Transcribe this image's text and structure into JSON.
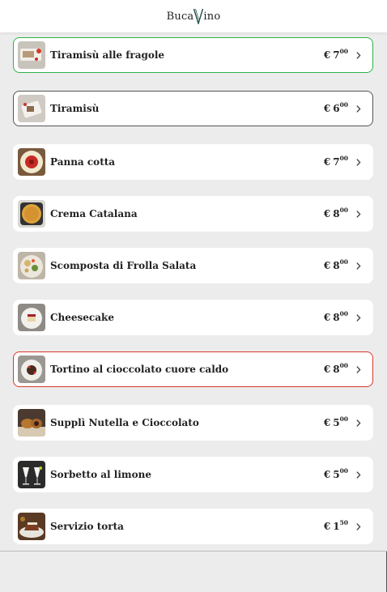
{
  "header": {
    "logo_left": "Buca",
    "logo_right": "ino"
  },
  "items": [
    {
      "name": "Tiramisù alle fragole",
      "currency": "€",
      "price_int": "7",
      "price_dec": "00",
      "border": "#2fb24a",
      "thumb": "plate-strawberry"
    },
    {
      "name": "Tiramisù",
      "currency": "€",
      "price_int": "6",
      "price_dec": "00",
      "border": "#555555",
      "thumb": "plate-tiramisu"
    },
    {
      "name": "Panna cotta",
      "currency": "€",
      "price_int": "7",
      "price_dec": "00",
      "border": "",
      "thumb": "plate-red"
    },
    {
      "name": "Crema Catalana",
      "currency": "€",
      "price_int": "8",
      "price_dec": "00",
      "border": "",
      "thumb": "plate-crema"
    },
    {
      "name": "Scomposta di Frolla Salata",
      "currency": "€",
      "price_int": "8",
      "price_dec": "00",
      "border": "",
      "thumb": "plate-scomposta"
    },
    {
      "name": "Cheesecake",
      "currency": "€",
      "price_int": "8",
      "price_dec": "00",
      "border": "",
      "thumb": "plate-cheesecake"
    },
    {
      "name": "Tortino al cioccolato cuore caldo",
      "currency": "€",
      "price_int": "8",
      "price_dec": "00",
      "border": "#d9372b",
      "thumb": "plate-tortino"
    },
    {
      "name": "Supplì Nutella e Cioccolato",
      "currency": "€",
      "price_int": "5",
      "price_dec": "00",
      "border": "",
      "thumb": "plate-suppli"
    },
    {
      "name": "Sorbetto al limone",
      "currency": "€",
      "price_int": "5",
      "price_dec": "00",
      "border": "",
      "thumb": "glass-sorbetto"
    },
    {
      "name": "Servizio torta",
      "currency": "€",
      "price_int": "1",
      "price_dec": "50",
      "border": "",
      "thumb": "plate-cake"
    }
  ]
}
